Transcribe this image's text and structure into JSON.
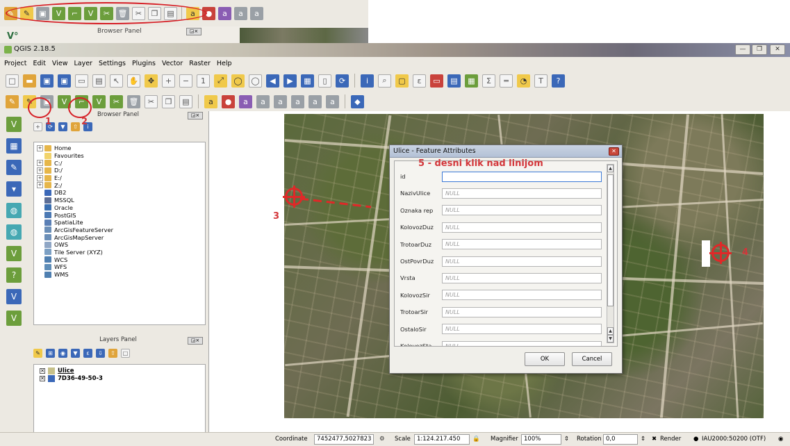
{
  "window": {
    "title": "QGIS 2.18.5"
  },
  "menu": [
    "Project",
    "Edit",
    "View",
    "Layer",
    "Settings",
    "Plugins",
    "Vector",
    "Raster",
    "Help"
  ],
  "top_strip": {
    "panel_title": "Browser Panel"
  },
  "browser_panel": {
    "title": "Browser Panel",
    "items": [
      {
        "label": "Home",
        "expand": true,
        "icon": "folder"
      },
      {
        "label": "Favourites",
        "expand": false,
        "icon": "star"
      },
      {
        "label": "C:/",
        "expand": true,
        "icon": "folder"
      },
      {
        "label": "D:/",
        "expand": true,
        "icon": "folder"
      },
      {
        "label": "E:/",
        "expand": true,
        "icon": "folder"
      },
      {
        "label": "Z:/",
        "expand": true,
        "icon": "folder"
      },
      {
        "label": "DB2",
        "expand": false,
        "icon": "db2"
      },
      {
        "label": "MSSQL",
        "expand": false,
        "icon": "mssql"
      },
      {
        "label": "Oracle",
        "expand": false,
        "icon": "oracle"
      },
      {
        "label": "PostGIS",
        "expand": false,
        "icon": "postgis"
      },
      {
        "label": "SpatiaLite",
        "expand": false,
        "icon": "spatialite"
      },
      {
        "label": "ArcGisFeatureServer",
        "expand": false,
        "icon": "arcgis"
      },
      {
        "label": "ArcGisMapServer",
        "expand": false,
        "icon": "arcgis"
      },
      {
        "label": "OWS",
        "expand": false,
        "icon": "ows"
      },
      {
        "label": "Tile Server (XYZ)",
        "expand": false,
        "icon": "tile"
      },
      {
        "label": "WCS",
        "expand": false,
        "icon": "wcs"
      },
      {
        "label": "WFS",
        "expand": false,
        "icon": "wfs"
      },
      {
        "label": "WMS",
        "expand": false,
        "icon": "wms"
      }
    ]
  },
  "layers_panel": {
    "title": "Layers Panel",
    "layers": [
      {
        "name": "Ulice",
        "checked": true,
        "icon": "line-layer"
      },
      {
        "name": "7D36-49-50-3",
        "checked": true,
        "icon": "raster-layer"
      }
    ]
  },
  "dialog": {
    "title": "Ulice - Feature Attributes",
    "fields": [
      {
        "label": "id",
        "value": ""
      },
      {
        "label": "NazivUlice",
        "value": "NULL"
      },
      {
        "label": "Oznaka rep",
        "value": "NULL"
      },
      {
        "label": "KolovozDuz",
        "value": "NULL"
      },
      {
        "label": "TrotoarDuz",
        "value": "NULL"
      },
      {
        "label": "OstPovrDuz",
        "value": "NULL"
      },
      {
        "label": "Vrsta",
        "value": "NULL"
      },
      {
        "label": "KolovozSir",
        "value": "NULL"
      },
      {
        "label": "TrotoarSir",
        "value": "NULL"
      },
      {
        "label": "OstaloSir",
        "value": "NULL"
      },
      {
        "label": "KolovozSta",
        "value": "NULL"
      }
    ],
    "ok_label": "OK",
    "cancel_label": "Cancel"
  },
  "annotations": {
    "n1": "1",
    "n2": "2",
    "n3": "3",
    "n4": "4",
    "n5": "5 - desni klik nad linijom"
  },
  "status": {
    "coordinate_label": "Coordinate",
    "coordinate_value": "7452477,5027823",
    "scale_label": "Scale",
    "scale_value": "1:124.217.450",
    "magnifier_label": "Magnifier",
    "magnifier_value": "100%",
    "rotation_label": "Rotation",
    "rotation_value": "0,0",
    "render_label": "Render",
    "crs_label": "IAU2000:50200 (OTF)"
  },
  "colors": {
    "accent_red": "#d61f26",
    "qgis_green": "#6c9e3c"
  }
}
